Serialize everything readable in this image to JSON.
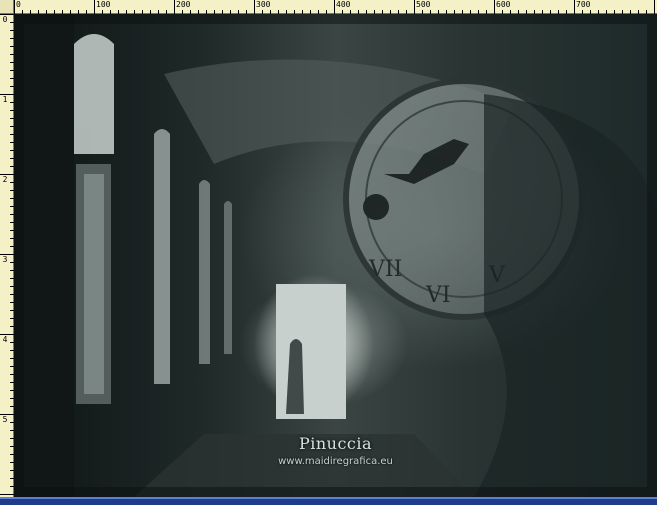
{
  "ruler": {
    "top_labels": [
      "0",
      "100",
      "200",
      "300",
      "400",
      "500",
      "600",
      "700"
    ],
    "left_labels": [
      "0",
      "1",
      "2",
      "3",
      "4",
      "5"
    ]
  },
  "image": {
    "title": "Pinuccia",
    "url": "www.maidiregrafica.eu"
  },
  "colors": {
    "ruler_bg": "#f4f1c7",
    "status_blue": "#1f3b8a",
    "canvas_dark": "#1f2a29"
  }
}
